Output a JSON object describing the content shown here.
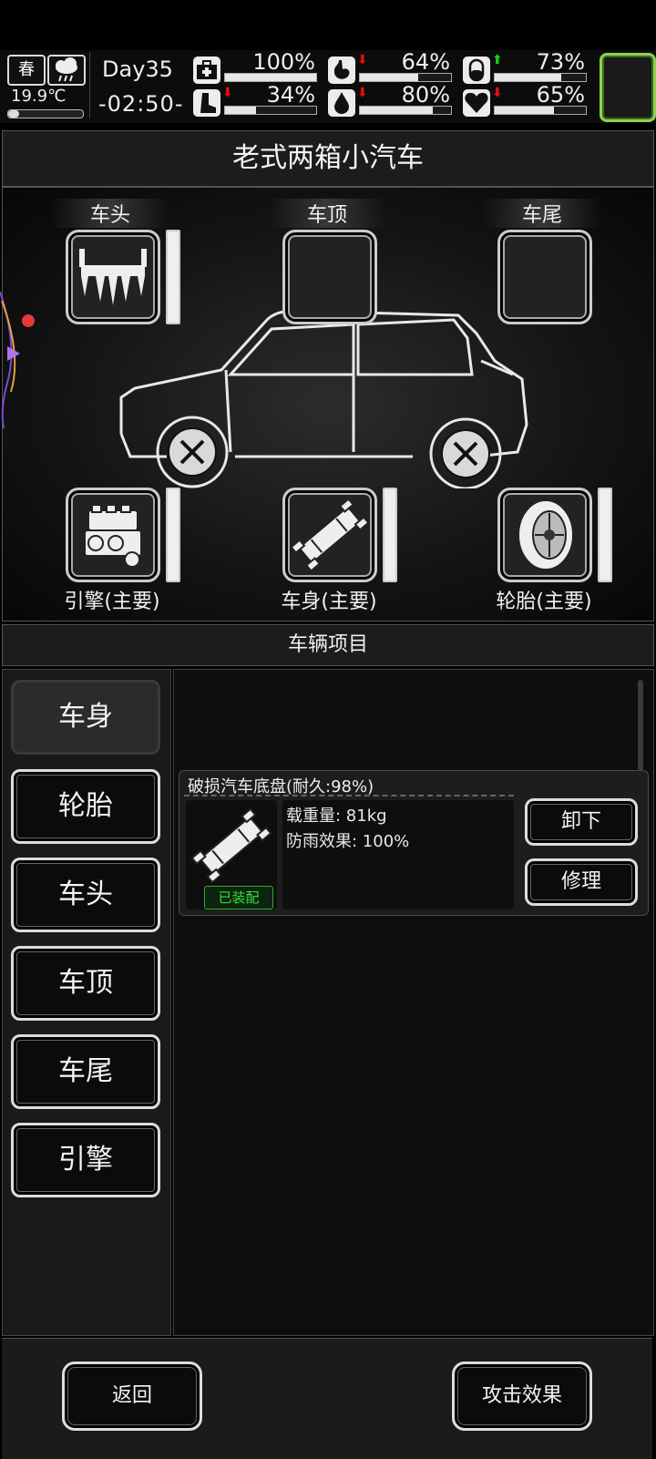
{
  "status": {
    "season": "春",
    "temperature": "19.9℃",
    "temperature_level": 0.15,
    "day": "Day35",
    "time": "-02:50-",
    "weather_icon": "cloud-rain-icon",
    "stats": [
      {
        "id": "health",
        "icon": "medkit-icon",
        "value": "100%",
        "level": 1.0,
        "trend": ""
      },
      {
        "id": "hunger",
        "icon": "stomach-icon",
        "value": "64%",
        "level": 0.64,
        "trend": "down"
      },
      {
        "id": "mood",
        "icon": "capsule-icon",
        "value": "73%",
        "level": 0.73,
        "trend": "up"
      },
      {
        "id": "stamina",
        "icon": "boot-icon",
        "value": "34%",
        "level": 0.34,
        "trend": "down"
      },
      {
        "id": "thirst",
        "icon": "water-drop-icon",
        "value": "80%",
        "level": 0.8,
        "trend": "down"
      },
      {
        "id": "spirit",
        "icon": "heart-icon",
        "value": "65%",
        "level": 0.65,
        "trend": "down"
      }
    ],
    "accent_green": "#8fd14f"
  },
  "vehicle": {
    "title": "老式两箱小汽车",
    "top_slots": [
      {
        "label": "车头",
        "item_icon": "spiked-bumper-icon"
      },
      {
        "label": "车顶",
        "item_icon": ""
      },
      {
        "label": "车尾",
        "item_icon": ""
      }
    ],
    "main_parts": [
      {
        "label": "引擎(主要)",
        "item_icon": "engine-icon"
      },
      {
        "label": "车身(主要)",
        "item_icon": "car-chassis-icon"
      },
      {
        "label": "轮胎(主要)",
        "item_icon": "tire-icon"
      }
    ]
  },
  "section_title": "车辆项目",
  "tabs": [
    "车身",
    "轮胎",
    "车头",
    "车顶",
    "车尾",
    "引擎"
  ],
  "active_tab": "车身",
  "item": {
    "name": "破损汽车底盘(耐久:98%)",
    "equipped_label": "已装配",
    "lines": [
      "载重量: 81kg",
      "防雨效果: 100%"
    ],
    "unequip_label": "卸下",
    "repair_label": "修理"
  },
  "bottom": {
    "back_label": "返回",
    "attack_label": "攻击效果"
  }
}
